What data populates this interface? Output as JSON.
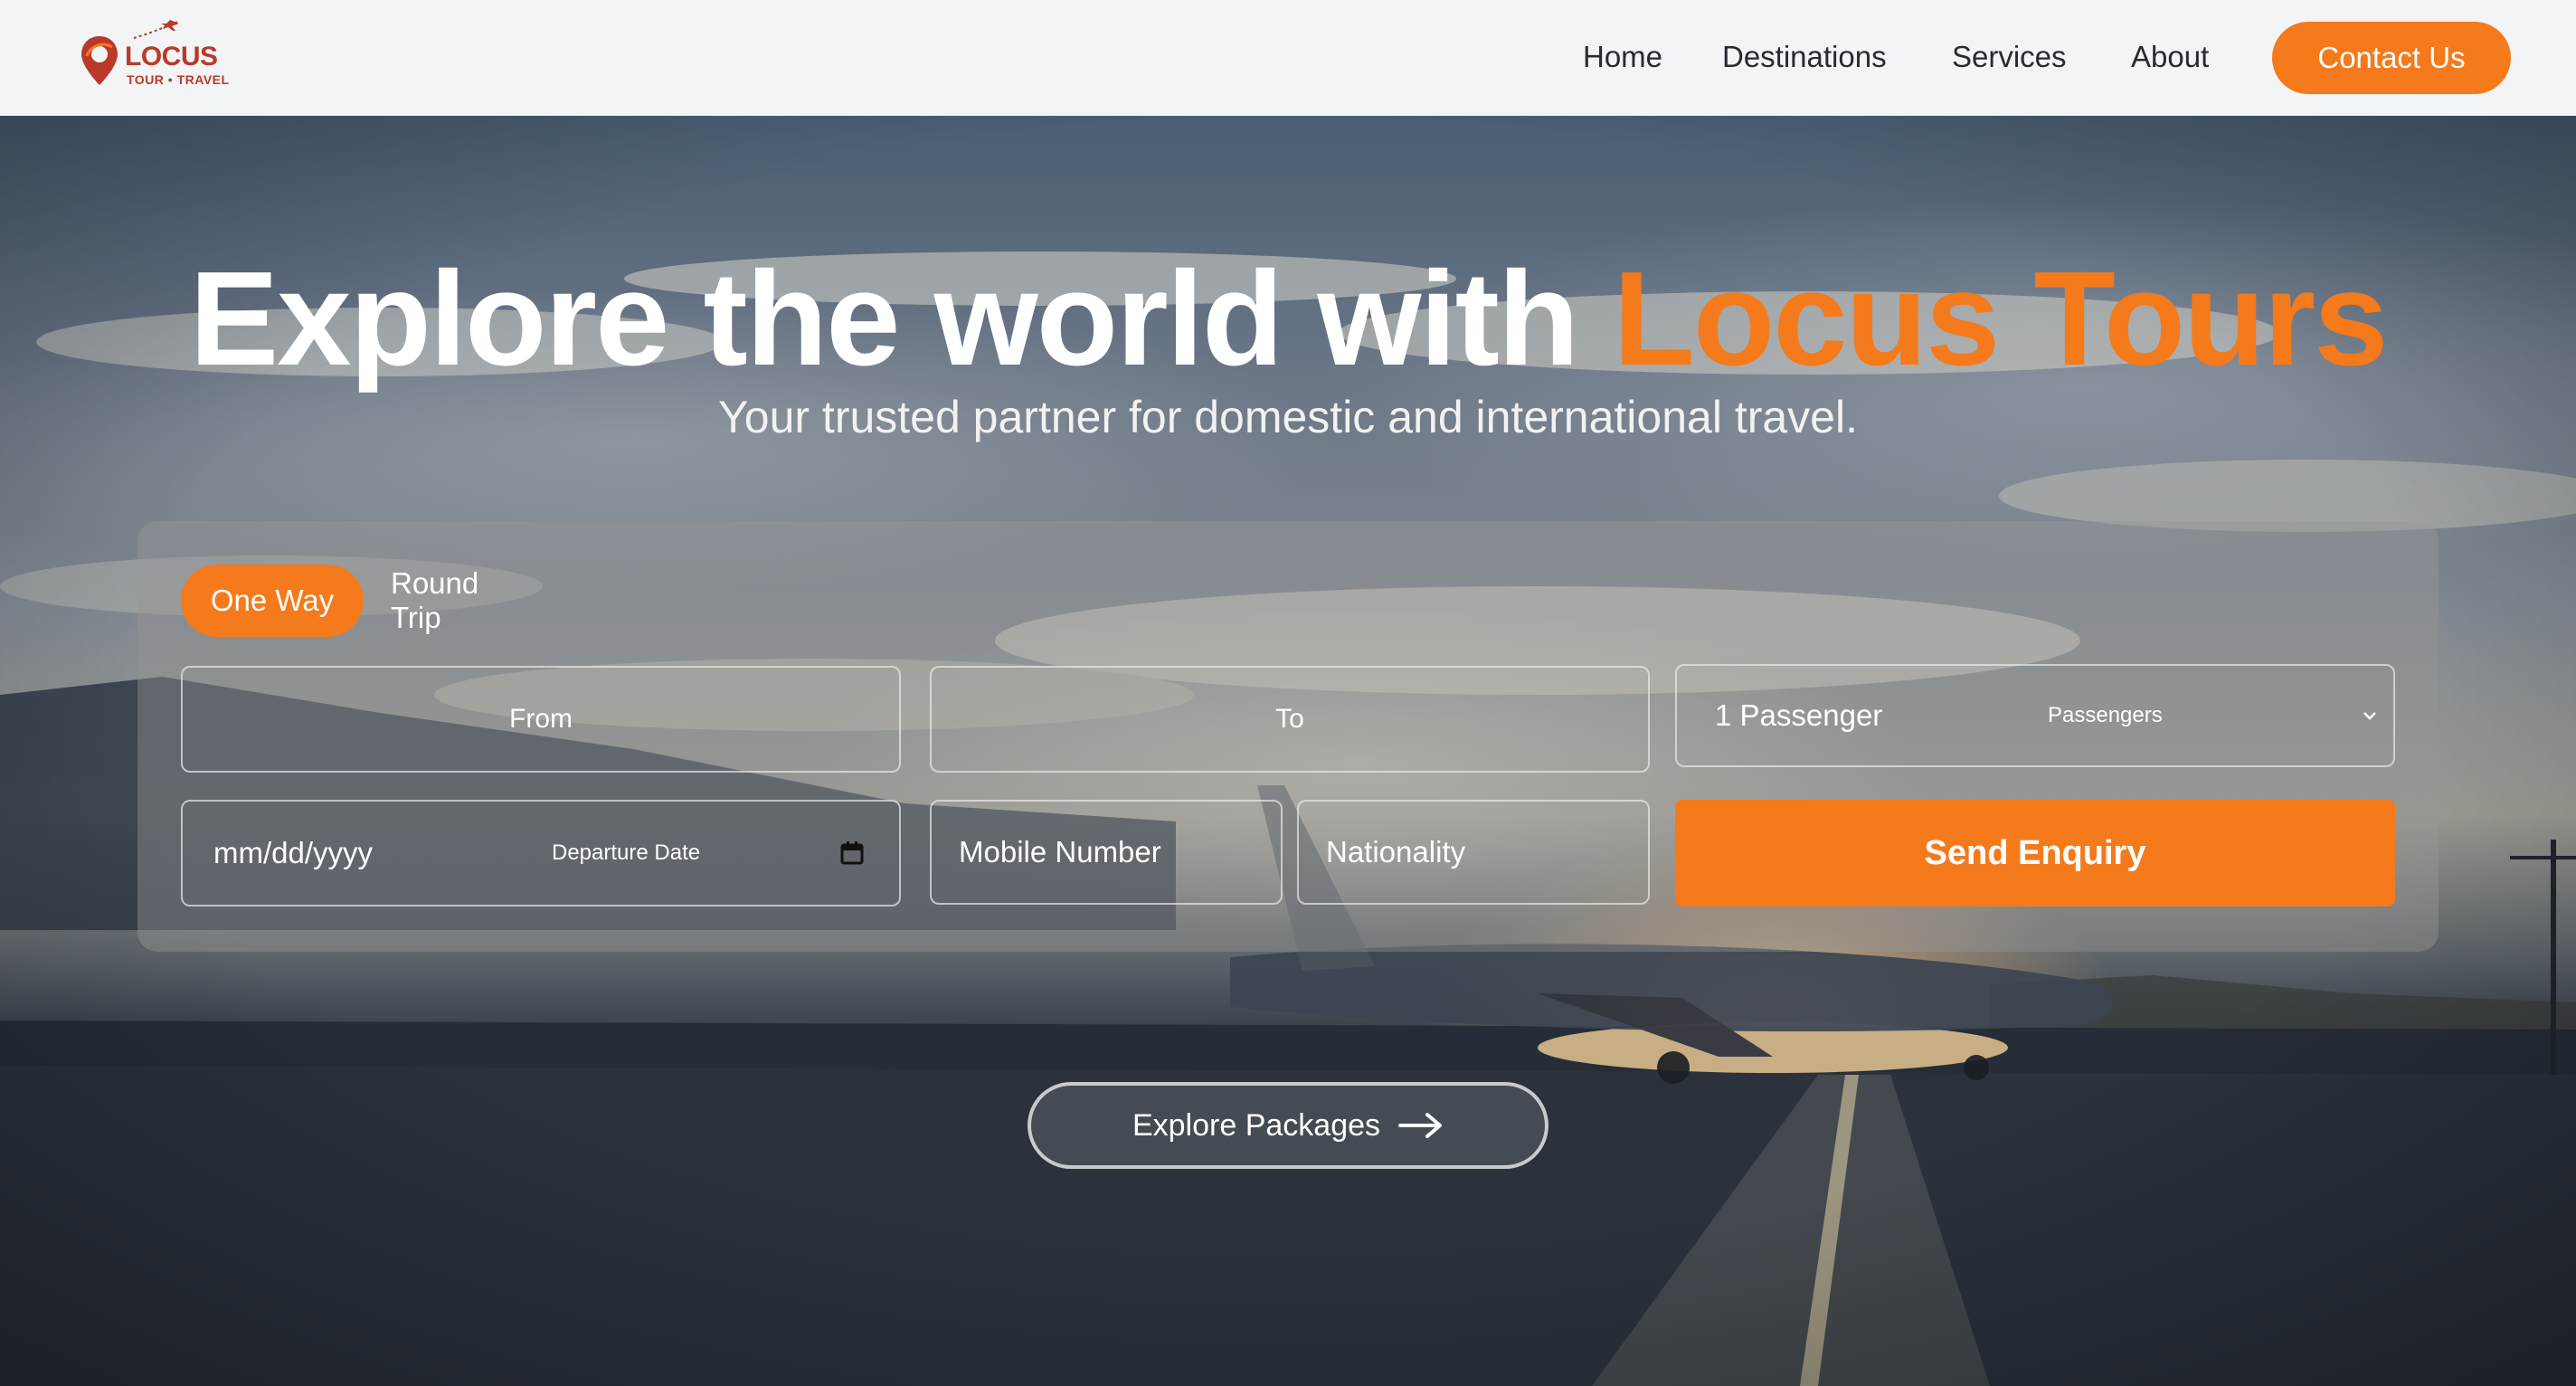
{
  "brand": {
    "name": "LOCUS",
    "tagline": "TOUR • TRAVEL",
    "logo_color": "#b83a2a"
  },
  "nav": {
    "items": [
      {
        "label": "Home"
      },
      {
        "label": "Destinations"
      },
      {
        "label": "Services"
      },
      {
        "label": "About"
      }
    ],
    "contact_label": "Contact Us"
  },
  "hero": {
    "headline_prefix": "Explore the world with ",
    "headline_accent": "Locus Tours",
    "subtitle": "Your trusted partner for domestic and international travel."
  },
  "booking": {
    "tabs": [
      {
        "label": "One Way",
        "active": true
      },
      {
        "label": "Round Trip",
        "active": false
      }
    ],
    "from_placeholder": "From",
    "to_placeholder": "To",
    "passengers_value": "1 Passenger",
    "passengers_label": "Passengers",
    "date_value": "mm/dd/yyyy",
    "date_label": "Departure Date",
    "mobile_placeholder": "Mobile Number",
    "nationality_placeholder": "Nationality",
    "submit_label": "Send Enquiry"
  },
  "explore": {
    "label": "Explore Packages"
  },
  "colors": {
    "accent": "#f47a1c",
    "header_bg": "#f3f4f6",
    "nav_text": "#262b33"
  },
  "icons": {
    "calendar": "calendar-icon",
    "chevron": "chevron-down-icon",
    "arrow": "arrow-right-icon",
    "pin": "location-pin-icon",
    "plane": "plane-icon"
  }
}
